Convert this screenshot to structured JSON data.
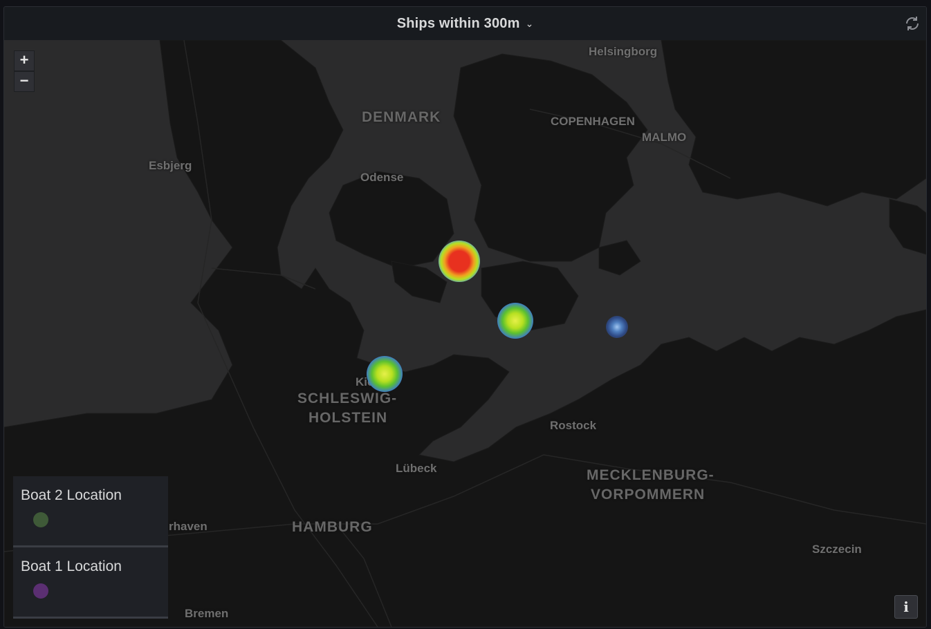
{
  "panel": {
    "title": "Ships within 300m",
    "menu_icon": "chevron-down-icon",
    "refresh_icon": "refresh-icon"
  },
  "map": {
    "zoom_in_label": "+",
    "zoom_out_label": "−",
    "info_label": "i",
    "labels": {
      "helsingborg": "Helsingborg",
      "denmark": "DENMARK",
      "copenhagen": "COPENHAGEN",
      "malmo": "MALMO",
      "esbjerg": "Esbjerg",
      "odense": "Odense",
      "kiel": "Kiel",
      "schleswig": "SCHLESWIG-",
      "holstein": "HOLSTEIN",
      "rostock": "Rostock",
      "lubeck": "Lübeck",
      "mecklenburg": "MECKLENBURG-",
      "vorpommern": "VORPOMMERN",
      "bremerhaven": "rhaven",
      "hamburg": "HAMBURG",
      "szczecin": "Szczecin",
      "bremen": "Bremen"
    },
    "heat_colors": {
      "high": "#e8311f",
      "medium": "#b7e021",
      "low": "#4f7fbf"
    }
  },
  "legend": [
    {
      "label": "Boat 2 Location",
      "color": "#3f5a38"
    },
    {
      "label": "Boat 1 Location",
      "color": "#5b2f72"
    }
  ]
}
